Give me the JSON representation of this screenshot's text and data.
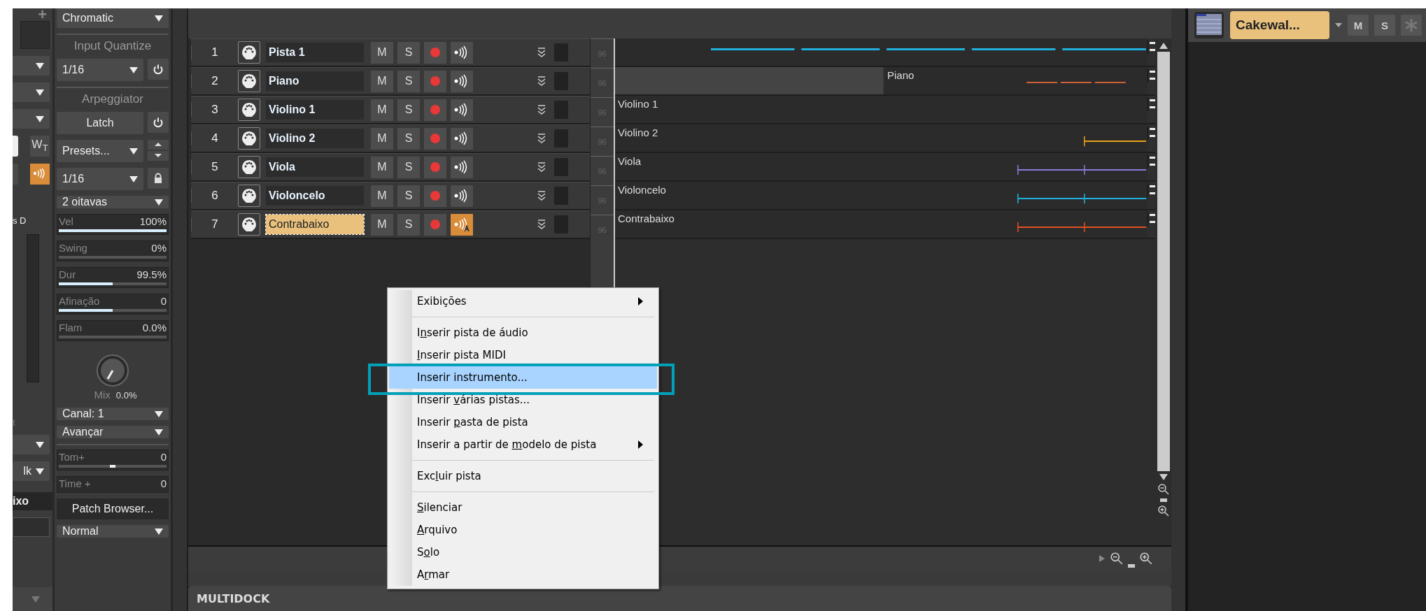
{
  "left_strip": {
    "plus": "+",
    "w_button": "W$_{T}$",
    "arp_on": true,
    "label_top": "s D",
    "label_mid": "t",
    "dropdown": "lk",
    "name": "ixo"
  },
  "inspector": {
    "chromatic": "Chromatic",
    "input_quantize": {
      "title": "Input Quantize",
      "value": "1/16"
    },
    "arpeggiator": {
      "title": "Arpeggiator",
      "latch": "Latch",
      "presets": "Presets...",
      "resolution": "1/16",
      "range": "2 oitavas"
    },
    "params": [
      {
        "label": "Vel",
        "value": "100%",
        "level": 1
      },
      {
        "label": "Swing",
        "value": "0%"
      },
      {
        "label": "Dur",
        "value": "99.5%",
        "level": 0.5
      },
      {
        "label": "Afinação",
        "value": "0",
        "level": 0.5
      },
      {
        "label": "Flam",
        "value": "0.0%"
      }
    ],
    "mix": {
      "label": "Mix",
      "value": "0.0%"
    },
    "channel": "Canal: 1",
    "mode": "Avançar",
    "tom": {
      "label": "Tom+",
      "value": "0",
      "level": 0.5
    },
    "time": {
      "label": "Time +",
      "value": "0"
    },
    "patch_browser": "Patch Browser...",
    "output": "Normal"
  },
  "tracks": [
    {
      "number": "1",
      "name": "Pista 1",
      "selected": false,
      "mute": "M",
      "solo": "S",
      "echo": false,
      "meter": "96"
    },
    {
      "number": "2",
      "name": "Piano",
      "selected": false,
      "mute": "M",
      "solo": "S",
      "echo": false,
      "meter": "96"
    },
    {
      "number": "3",
      "name": "Violino 1",
      "selected": false,
      "mute": "M",
      "solo": "S",
      "echo": false,
      "meter": "96"
    },
    {
      "number": "4",
      "name": "Violino 2",
      "selected": false,
      "mute": "M",
      "solo": "S",
      "echo": false,
      "meter": "96"
    },
    {
      "number": "5",
      "name": "Viola",
      "selected": false,
      "mute": "M",
      "solo": "S",
      "echo": false,
      "meter": "96"
    },
    {
      "number": "6",
      "name": "Violoncelo",
      "selected": false,
      "mute": "M",
      "solo": "S",
      "echo": false,
      "meter": "96"
    },
    {
      "number": "7",
      "name": "Contrabaixo",
      "selected": true,
      "mute": "M",
      "solo": "S",
      "echo": true,
      "meter": "96"
    }
  ],
  "lanes": [
    {
      "kind": "dense",
      "color": "#1fb0de"
    },
    {
      "kind": "sparse",
      "name": "Piano",
      "color": "#d0603c"
    },
    {
      "kind": "empty",
      "name": "Violino 1"
    },
    {
      "kind": "short",
      "name": "Violino 2",
      "color": "#e6a018"
    },
    {
      "kind": "tail",
      "name": "Viola",
      "color": "#8a7ad8"
    },
    {
      "kind": "tail",
      "name": "Violoncelo",
      "color": "#1fb0de"
    },
    {
      "kind": "tail",
      "name": "Contrabaixo",
      "color": "#e0501e"
    }
  ],
  "right_panel": {
    "synth_name": "Cakewal...",
    "mute": "M",
    "solo": "S"
  },
  "multidock": {
    "title": "MULTIDOCK"
  },
  "context_menu": {
    "groups": [
      [
        {
          "text": "Exibições",
          "submenu": true,
          "selected": false
        }
      ],
      [
        {
          "before": "I",
          "key": "n",
          "after": "serir pista de áudio",
          "submenu": false,
          "selected": false
        },
        {
          "key": "I",
          "after": "nserir pista MIDI",
          "submenu": false,
          "selected": false
        },
        {
          "text": "Inserir instrumento...",
          "submenu": false,
          "selected": true
        },
        {
          "before": "Inserir ",
          "key": "v",
          "after": "árias pistas...",
          "submenu": false,
          "selected": false
        },
        {
          "before": "Inserir ",
          "key": "p",
          "after": "asta de pista",
          "submenu": false,
          "selected": false
        },
        {
          "before": "Inserir a partir de ",
          "key": "m",
          "after": "odelo de pista",
          "submenu": true,
          "selected": false
        }
      ],
      [
        {
          "before": "Exc",
          "key": "l",
          "after": "uir pista",
          "submenu": false,
          "selected": false
        }
      ],
      [
        {
          "key": "S",
          "after": "ilenciar",
          "submenu": false,
          "selected": false
        },
        {
          "key": "A",
          "after": "rquivo",
          "submenu": false,
          "selected": false
        },
        {
          "before": "S",
          "key": "o",
          "after": "lo",
          "submenu": false,
          "selected": false
        },
        {
          "before": "A",
          "key": "r",
          "after": "mar",
          "submenu": false,
          "selected": false
        }
      ]
    ]
  }
}
